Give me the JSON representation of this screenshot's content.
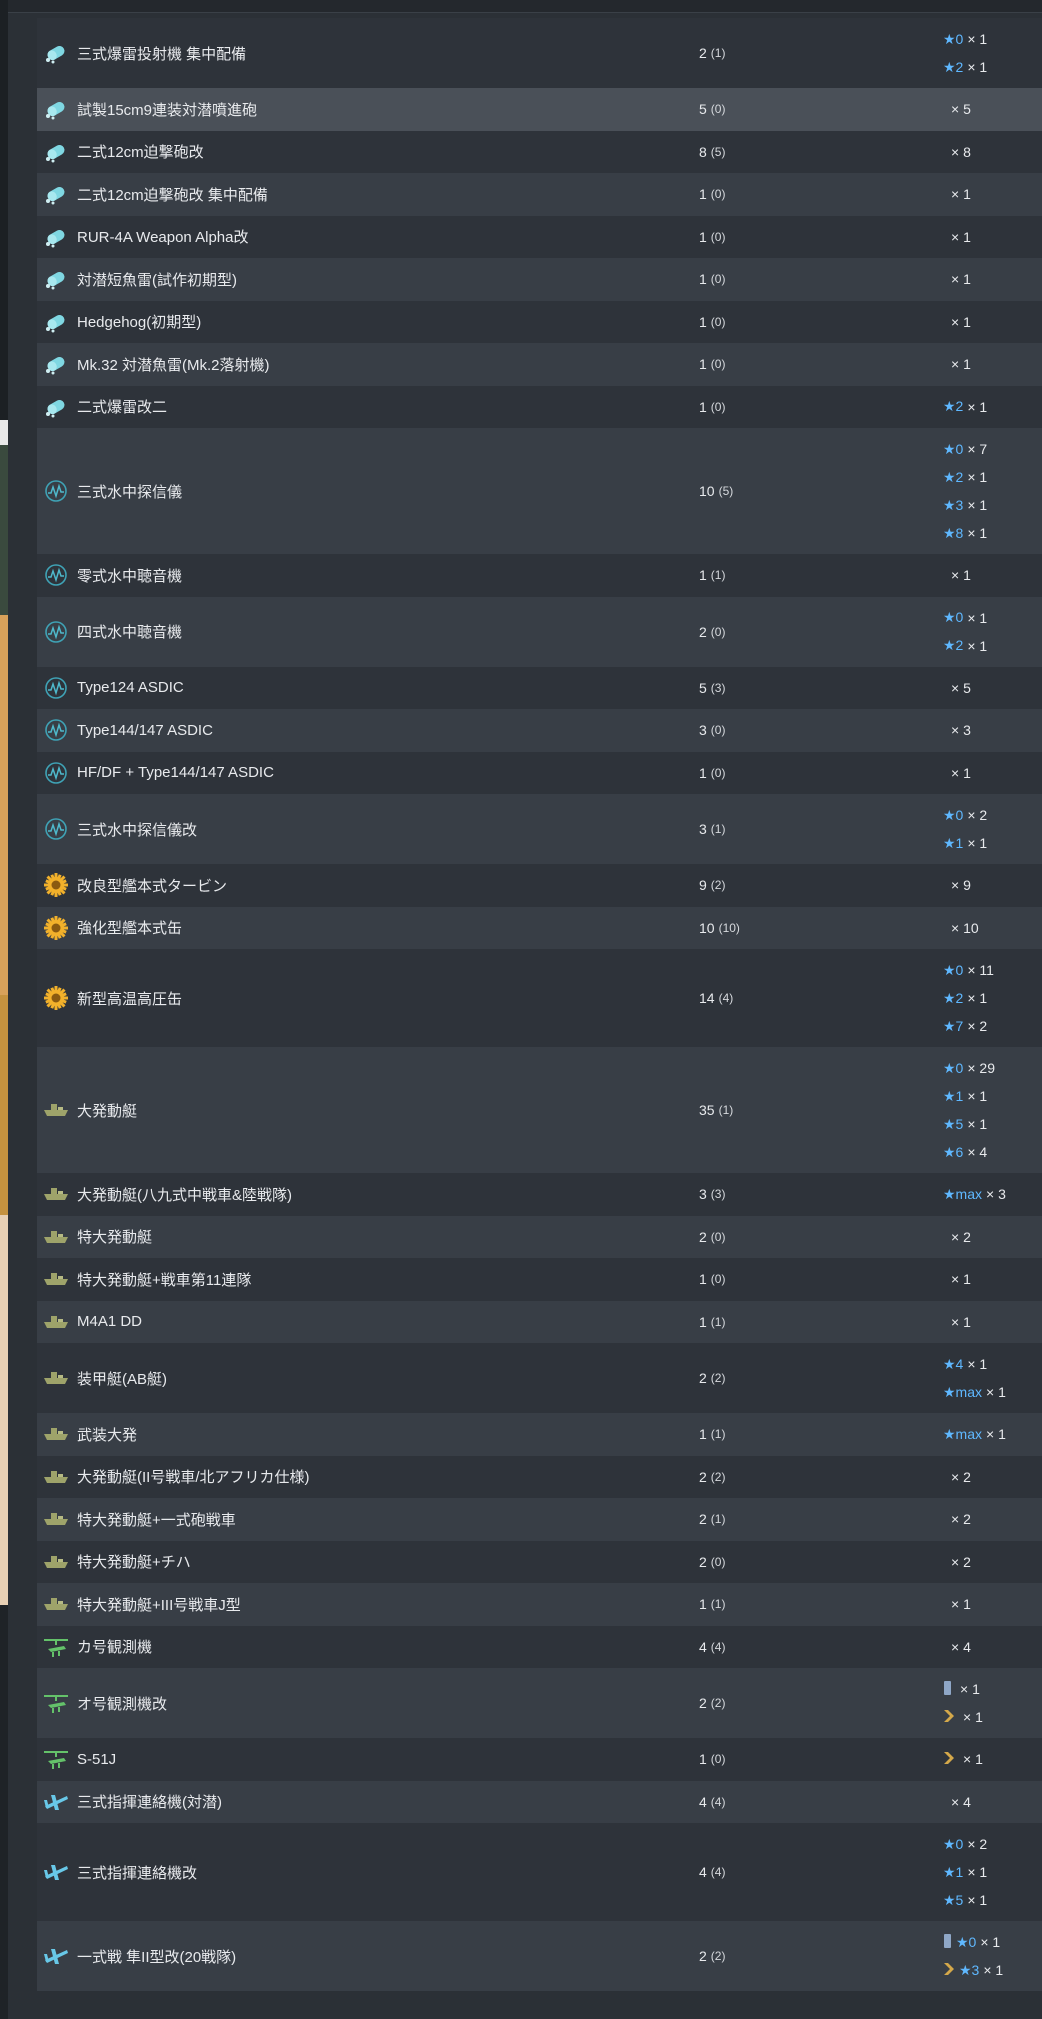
{
  "colors": {
    "star": "#5fb8ff",
    "depth_charge_icon": "#7fd7e2",
    "sonar_icon": "#3fa2b5",
    "engine_icon": "#f2b12b",
    "landing_craft_icon": "#9ea36a",
    "autogyro_icon": "#64c26a",
    "liaison_plane_icon": "#68c8e8"
  },
  "rows": [
    {
      "name": "三式爆雷投射機 集中配備",
      "icon": "depth-charge",
      "count": "2",
      "sub": "(1)",
      "levels": [
        {
          "star": "★0",
          "mult": "× 1"
        },
        {
          "star": "★2",
          "mult": "× 1"
        }
      ]
    },
    {
      "name": "試製15cm9連装対潜噴進砲",
      "icon": "depth-charge",
      "count": "5",
      "sub": "(0)",
      "hover": true,
      "levels": [
        {
          "mult": "× 5"
        }
      ]
    },
    {
      "name": "二式12cm迫撃砲改",
      "icon": "depth-charge",
      "count": "8",
      "sub": "(5)",
      "levels": [
        {
          "mult": "× 8"
        }
      ]
    },
    {
      "name": "二式12cm迫撃砲改 集中配備",
      "icon": "depth-charge",
      "count": "1",
      "sub": "(0)",
      "levels": [
        {
          "mult": "× 1"
        }
      ]
    },
    {
      "name": "RUR-4A Weapon Alpha改",
      "icon": "depth-charge",
      "count": "1",
      "sub": "(0)",
      "levels": [
        {
          "mult": "× 1"
        }
      ]
    },
    {
      "name": "対潜短魚雷(試作初期型)",
      "icon": "depth-charge",
      "count": "1",
      "sub": "(0)",
      "levels": [
        {
          "mult": "× 1"
        }
      ]
    },
    {
      "name": "Hedgehog(初期型)",
      "icon": "depth-charge",
      "count": "1",
      "sub": "(0)",
      "levels": [
        {
          "mult": "× 1"
        }
      ]
    },
    {
      "name": "Mk.32 対潜魚雷(Mk.2落射機)",
      "icon": "depth-charge",
      "count": "1",
      "sub": "(0)",
      "levels": [
        {
          "mult": "× 1"
        }
      ]
    },
    {
      "name": "二式爆雷改二",
      "icon": "depth-charge",
      "count": "1",
      "sub": "(0)",
      "levels": [
        {
          "star": "★2",
          "mult": "× 1"
        }
      ]
    },
    {
      "name": "三式水中探信儀",
      "icon": "sonar",
      "count": "10",
      "sub": "(5)",
      "levels": [
        {
          "star": "★0",
          "mult": "× 7"
        },
        {
          "star": "★2",
          "mult": "× 1"
        },
        {
          "star": "★3",
          "mult": "× 1"
        },
        {
          "star": "★8",
          "mult": "× 1"
        }
      ]
    },
    {
      "name": "零式水中聴音機",
      "icon": "sonar",
      "count": "1",
      "sub": "(1)",
      "levels": [
        {
          "mult": "× 1"
        }
      ]
    },
    {
      "name": "四式水中聴音機",
      "icon": "sonar",
      "count": "2",
      "sub": "(0)",
      "levels": [
        {
          "star": "★0",
          "mult": "× 1"
        },
        {
          "star": "★2",
          "mult": "× 1"
        }
      ]
    },
    {
      "name": "Type124 ASDIC",
      "icon": "sonar",
      "count": "5",
      "sub": "(3)",
      "levels": [
        {
          "mult": "× 5"
        }
      ]
    },
    {
      "name": "Type144/147 ASDIC",
      "icon": "sonar",
      "count": "3",
      "sub": "(0)",
      "levels": [
        {
          "mult": "× 3"
        }
      ]
    },
    {
      "name": "HF/DF + Type144/147 ASDIC",
      "icon": "sonar",
      "count": "1",
      "sub": "(0)",
      "levels": [
        {
          "mult": "× 1"
        }
      ]
    },
    {
      "name": "三式水中探信儀改",
      "icon": "sonar",
      "count": "3",
      "sub": "(1)",
      "levels": [
        {
          "star": "★0",
          "mult": "× 2"
        },
        {
          "star": "★1",
          "mult": "× 1"
        }
      ]
    },
    {
      "name": "改良型艦本式タービン",
      "icon": "engine",
      "count": "9",
      "sub": "(2)",
      "levels": [
        {
          "mult": "× 9"
        }
      ]
    },
    {
      "name": "強化型艦本式缶",
      "icon": "engine",
      "count": "10",
      "sub": "(10)",
      "levels": [
        {
          "mult": "× 10"
        }
      ]
    },
    {
      "name": "新型高温高圧缶",
      "icon": "engine",
      "count": "14",
      "sub": "(4)",
      "levels": [
        {
          "star": "★0",
          "mult": "× 11"
        },
        {
          "star": "★2",
          "mult": "× 1"
        },
        {
          "star": "★7",
          "mult": "× 2"
        }
      ]
    },
    {
      "name": "大発動艇",
      "icon": "landing-craft",
      "count": "35",
      "sub": "(1)",
      "levels": [
        {
          "star": "★0",
          "mult": "× 29"
        },
        {
          "star": "★1",
          "mult": "× 1"
        },
        {
          "star": "★5",
          "mult": "× 1"
        },
        {
          "star": "★6",
          "mult": "× 4"
        }
      ]
    },
    {
      "name": "大発動艇(八九式中戦車&陸戦隊)",
      "icon": "landing-craft",
      "count": "3",
      "sub": "(3)",
      "levels": [
        {
          "star": "★max",
          "mult": "× 3"
        }
      ]
    },
    {
      "name": "特大発動艇",
      "icon": "landing-craft",
      "count": "2",
      "sub": "(0)",
      "levels": [
        {
          "mult": "× 2"
        }
      ]
    },
    {
      "name": "特大発動艇+戦車第11連隊",
      "icon": "landing-craft",
      "count": "1",
      "sub": "(0)",
      "levels": [
        {
          "mult": "× 1"
        }
      ]
    },
    {
      "name": "M4A1 DD",
      "icon": "landing-craft",
      "count": "1",
      "sub": "(1)",
      "levels": [
        {
          "mult": "× 1"
        }
      ]
    },
    {
      "name": "装甲艇(AB艇)",
      "icon": "landing-craft",
      "count": "2",
      "sub": "(2)",
      "levels": [
        {
          "star": "★4",
          "mult": "× 1"
        },
        {
          "star": "★max",
          "mult": "× 1"
        }
      ]
    },
    {
      "name": "武装大発",
      "icon": "landing-craft",
      "count": "1",
      "sub": "(1)",
      "levels": [
        {
          "star": "★max",
          "mult": "× 1"
        }
      ]
    },
    {
      "name": "大発動艇(II号戦車/北アフリカ仕様)",
      "icon": "landing-craft",
      "count": "2",
      "sub": "(2)",
      "levels": [
        {
          "mult": "× 2"
        }
      ]
    },
    {
      "name": "特大発動艇+一式砲戦車",
      "icon": "landing-craft",
      "count": "2",
      "sub": "(1)",
      "levels": [
        {
          "mult": "× 2"
        }
      ]
    },
    {
      "name": "特大発動艇+チハ",
      "icon": "landing-craft",
      "count": "2",
      "sub": "(0)",
      "levels": [
        {
          "mult": "× 2"
        }
      ]
    },
    {
      "name": "特大発動艇+III号戦車J型",
      "icon": "landing-craft",
      "count": "1",
      "sub": "(1)",
      "levels": [
        {
          "mult": "× 1"
        }
      ]
    },
    {
      "name": "カ号観測機",
      "icon": "autogyro",
      "count": "4",
      "sub": "(4)",
      "levels": [
        {
          "mult": "× 4"
        }
      ]
    },
    {
      "name": "オ号観測機改",
      "icon": "autogyro",
      "count": "2",
      "sub": "(2)",
      "levels": [
        {
          "tag": "proficiency-bar",
          "mult": "× 1"
        },
        {
          "tag": "proficiency-chevron",
          "mult": "× 1"
        }
      ]
    },
    {
      "name": "S-51J",
      "icon": "autogyro",
      "count": "1",
      "sub": "(0)",
      "levels": [
        {
          "tag": "proficiency-chevron",
          "mult": "× 1"
        }
      ]
    },
    {
      "name": "三式指揮連絡機(対潜)",
      "icon": "liaison-plane",
      "count": "4",
      "sub": "(4)",
      "levels": [
        {
          "mult": "× 4"
        }
      ]
    },
    {
      "name": "三式指揮連絡機改",
      "icon": "liaison-plane",
      "count": "4",
      "sub": "(4)",
      "levels": [
        {
          "star": "★0",
          "mult": "× 2"
        },
        {
          "star": "★1",
          "mult": "× 1"
        },
        {
          "star": "★5",
          "mult": "× 1"
        }
      ]
    },
    {
      "name": "一式戦 隼II型改(20戦隊)",
      "icon": "liaison-plane",
      "count": "2",
      "sub": "(2)",
      "levels": [
        {
          "tag": "proficiency-bar",
          "star": "★0",
          "mult": "× 1"
        },
        {
          "tag": "proficiency-chevron",
          "star": "★3",
          "mult": "× 1"
        }
      ]
    }
  ]
}
